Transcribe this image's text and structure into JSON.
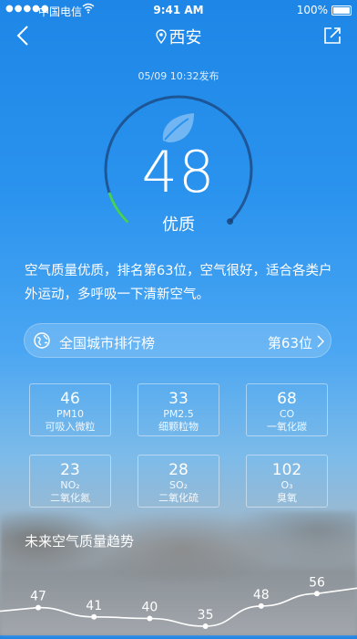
{
  "status_bar": {
    "signal": "●●●●●",
    "carrier": "中国电信",
    "time": "9:41 AM",
    "battery": "100%"
  },
  "nav": {
    "city": "西安",
    "back_icon": "chevron-left-icon",
    "share_icon": "share-icon",
    "location_icon": "location-pin-icon"
  },
  "aqi": {
    "published": "05/09 10:32发布",
    "value": "48",
    "level": "优质",
    "fraction": 0.096,
    "icon": "leaf-icon",
    "accent_color": "#46d05c"
  },
  "description": "空气质量优质，排名第63位，空气很好，适合各类户外运动，多呼吸一下清新空气。",
  "ranking": {
    "icon": "globe-icon",
    "label": "全国城市排行榜",
    "value": "第63位",
    "chevron_icon": "chevron-right-icon"
  },
  "pollutants": [
    {
      "value": "46",
      "name": "PM10",
      "desc": "可吸入微粒"
    },
    {
      "value": "33",
      "name": "PM2.5",
      "desc": "细颗粒物"
    },
    {
      "value": "68",
      "name": "CO",
      "desc": "一氧化碳"
    },
    {
      "value": "23",
      "name": "NO₂",
      "desc": "二氧化氮"
    },
    {
      "value": "28",
      "name": "SO₂",
      "desc": "二氧化硫"
    },
    {
      "value": "102",
      "name": "O₃",
      "desc": "臭氧"
    }
  ],
  "trend": {
    "title": "未来空气质量趋势",
    "values": [
      47,
      41,
      40,
      35,
      48,
      56
    ]
  }
}
